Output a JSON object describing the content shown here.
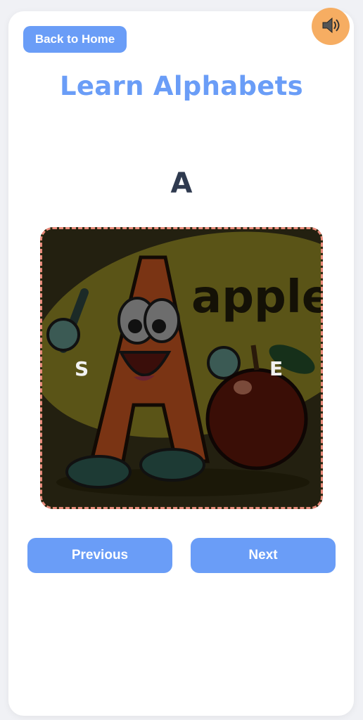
{
  "header": {
    "back_label": "Back to Home",
    "title": "Learn Alphabets"
  },
  "sound": {
    "icon": "speaker-icon"
  },
  "lesson": {
    "letter": "A",
    "image_word": "apple",
    "image_text_left": "S",
    "image_text_right": "E"
  },
  "nav": {
    "previous_label": "Previous",
    "next_label": "Next"
  },
  "colors": {
    "accent": "#6a9df7",
    "sound_button": "#f6ad62",
    "frame_border": "#e88a7a",
    "letter_text": "#2f3a4f"
  }
}
